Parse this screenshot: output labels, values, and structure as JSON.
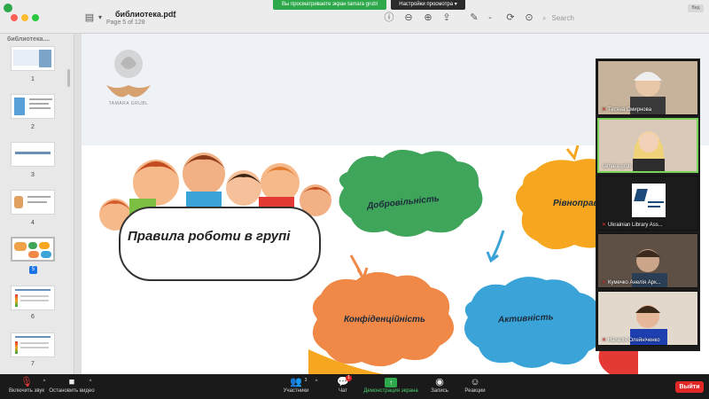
{
  "share_banner": "Вы просматриваете экран tamara grubl",
  "view_settings": "Настройки просмотра",
  "document": {
    "title": "библиотека.pdf",
    "page_info": "Page 5 of 128",
    "search_placeholder": "Search"
  },
  "user_badge": "Вид",
  "sidebar": {
    "title": "библиотека....",
    "pages": [
      "1",
      "2",
      "3",
      "4",
      "5",
      "6",
      "7"
    ],
    "selected_page": "5"
  },
  "slide": {
    "logo_text": "TAMARA GRUBL",
    "rules_heading": "Правила роботи в групі",
    "clouds": [
      "Добровільність",
      "Рівноправ",
      "Конфіденційність",
      "Активність"
    ]
  },
  "participants": [
    {
      "name": "Тетяна Смирнова",
      "muted": true
    },
    {
      "name": "tamara grub",
      "muted": false
    },
    {
      "name": "Ukrainian Library Ass...",
      "muted": true
    },
    {
      "name": "Кумечко Анелія Арк...",
      "muted": true
    },
    {
      "name": "Наталія Олейніченко",
      "muted": true
    }
  ],
  "toolbar": {
    "mute": "Включить звук",
    "video": "Остановить видео",
    "participants": "Участники",
    "participants_count": "3",
    "chat": "Чат",
    "chat_badge": "1",
    "share": "Демонстрация экрана",
    "record": "Запись",
    "reactions": "Реакции",
    "leave": "Выйти"
  },
  "colors": {
    "share_green": "#2da84a",
    "leave_red": "#e02828",
    "cloud_green": "#3ea55a",
    "cloud_orange": "#f08848",
    "cloud_blue": "#3aa4d8",
    "cloud_yellow": "#f6a61f"
  }
}
